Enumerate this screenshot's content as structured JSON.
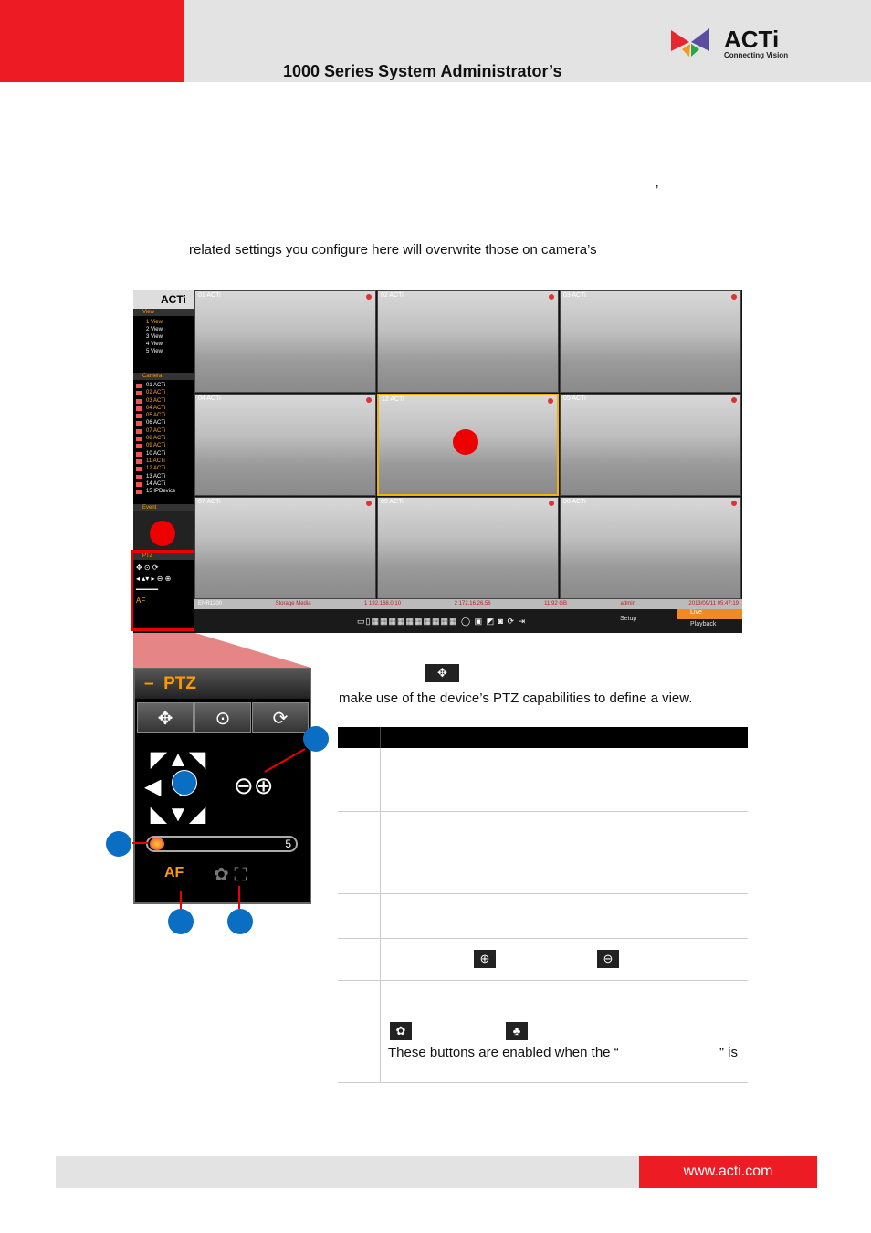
{
  "header": {
    "title": "1000 Series System Administrator’s",
    "logo_text": "ACTi",
    "logo_tagline": "Connecting Vision",
    "accent": "#ed1c24"
  },
  "body": {
    "apostrophe": "’",
    "line1": "related settings you configure here will overwrite those on camera’s",
    "line2": "make use of the device’s PTZ capabilities to define a view.",
    "row5_text": "These buttons are enabled when the “",
    "row5_tail": "” is"
  },
  "screenshot": {
    "logo": "ACTi",
    "view_header": "View",
    "views": [
      "1 View",
      "2 View",
      "3 View",
      "4 View",
      "5 View"
    ],
    "camera_header": "Camera",
    "cameras": [
      {
        "n": "01 ACTi",
        "o": false
      },
      {
        "n": "02 ACTi",
        "o": true
      },
      {
        "n": "03 ACTi",
        "o": true
      },
      {
        "n": "04 ACTi",
        "o": true
      },
      {
        "n": "05 ACTi",
        "o": true
      },
      {
        "n": "06 ACTi",
        "o": false
      },
      {
        "n": "07 ACTi",
        "o": true
      },
      {
        "n": "08 ACTi",
        "o": true
      },
      {
        "n": "09 ACTi",
        "o": true
      },
      {
        "n": "10 ACTi",
        "o": false
      },
      {
        "n": "11 ACTi",
        "o": true
      },
      {
        "n": "12 ACTi",
        "o": true
      },
      {
        "n": "13 ACTi",
        "o": false
      },
      {
        "n": "14 ACTi",
        "o": false
      },
      {
        "n": "15 IPDevice",
        "o": false
      }
    ],
    "event_header": "Event",
    "ptz_header": "PTZ",
    "cells": [
      "01 ACTi",
      "02 ACTi",
      "03 ACTi",
      "04 ACTi",
      "12 ACTi",
      "05 ACTi",
      "07 ACTi",
      "09 ACTi",
      "08 ACTi"
    ],
    "status": {
      "device": "ENR1200",
      "storage": "Storage Media",
      "ip1": "1 192.168.0.10",
      "ip2": "2 172.16.26.56",
      "disk": "11.92 GB",
      "user": "admin",
      "time": "2013/09/11 05:47:19"
    },
    "setup": "Setup",
    "live": "Live",
    "playback": "Playback"
  },
  "ptz_panel": {
    "title": "PTZ",
    "speed": "5"
  },
  "footer": {
    "url": "www.acti.com"
  }
}
